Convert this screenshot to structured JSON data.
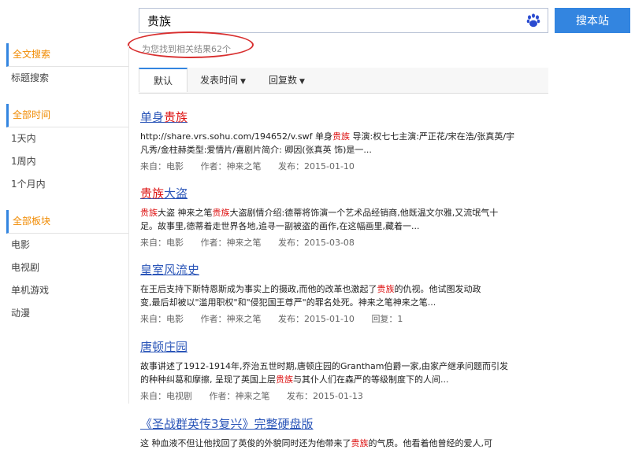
{
  "search": {
    "query": "贵族",
    "button_label": "搜本站"
  },
  "result_summary": "为您找到相关结果62个",
  "sidebar": {
    "groups": [
      {
        "items": [
          "全文搜索",
          "标题搜索"
        ]
      },
      {
        "items": [
          "全部时间",
          "1天内",
          "1周内",
          "1个月内"
        ]
      },
      {
        "items": [
          "全部板块",
          "电影",
          "电视剧",
          "单机游戏",
          "动漫"
        ]
      }
    ]
  },
  "tabs": [
    "默认",
    "发表时间",
    "回复数"
  ],
  "results": [
    {
      "title_parts": [
        "单身",
        "贵族"
      ],
      "abstract_lines": [
        "http://share.vrs.sohu.com/194652/v.swf 单身贵族 导演:权七七主演:严正花/宋在浩/张真英/宇",
        "凡秀/金柱赫类型:爱情片/喜剧片简介: 卿因(张真英 饰)是一..."
      ],
      "meta": {
        "source": "来自：电影",
        "author": "作者：神来之笔",
        "date": "发布：2015-01-10"
      }
    },
    {
      "title_parts": [
        "贵族",
        "大盗"
      ],
      "abstract_lines": [
        "贵族大盗 神来之笔贵族大盗剧情介绍:德蒂将饰演一个艺术品经销商,他既温文尔雅,又流氓气十",
        "足。故事里,德蒂着走世界各地,追寻一副被盗的画作,在这幅画里,藏着一..."
      ],
      "meta": {
        "source": "来自：电影",
        "author": "作者：神来之笔",
        "date": "发布：2015-03-08"
      }
    },
    {
      "title_parts": [
        "皇室风流史"
      ],
      "abstract_lines": [
        "在王后支持下斯特恩斯成为事实上的摄政,而他的改革也激起了贵族的仇视。他试图发动政",
        "变,最后却被以\"滥用职权\"和\"侵犯国王尊严\"的罪名处死。神来之笔神来之笔..."
      ],
      "meta": {
        "source": "来自：电影",
        "author": "作者：神来之笔",
        "date": "发布：2015-01-10",
        "replies": "回复：1"
      }
    },
    {
      "title_parts": [
        "唐顿庄园"
      ],
      "abstract_lines": [
        "故事讲述了1912-1914年,乔治五世时期,唐顿庄园的Grantham伯爵一家,由家产继承问题而引发",
        "的种种纠葛和摩擦, 呈现了英国上层贵族与其仆人们在森严的等级制度下的人间..."
      ],
      "meta": {
        "source": "来自：电视剧",
        "author": "作者：神来之笔",
        "date": "发布：2015-01-13"
      }
    },
    {
      "title_parts": [
        "《圣战群英传3复兴》完整硬盘版"
      ],
      "abstract_lines": [
        "这 种血液不但让他找回了英俊的外貌同时还为他带来了贵族的气质。他看着他曾经的爱人,可"
      ]
    }
  ],
  "colors": {
    "accent": "#3385e0",
    "active_orange": "#f08a00",
    "highlight_red": "#dd1111",
    "annotation_red": "#d82f2f"
  }
}
